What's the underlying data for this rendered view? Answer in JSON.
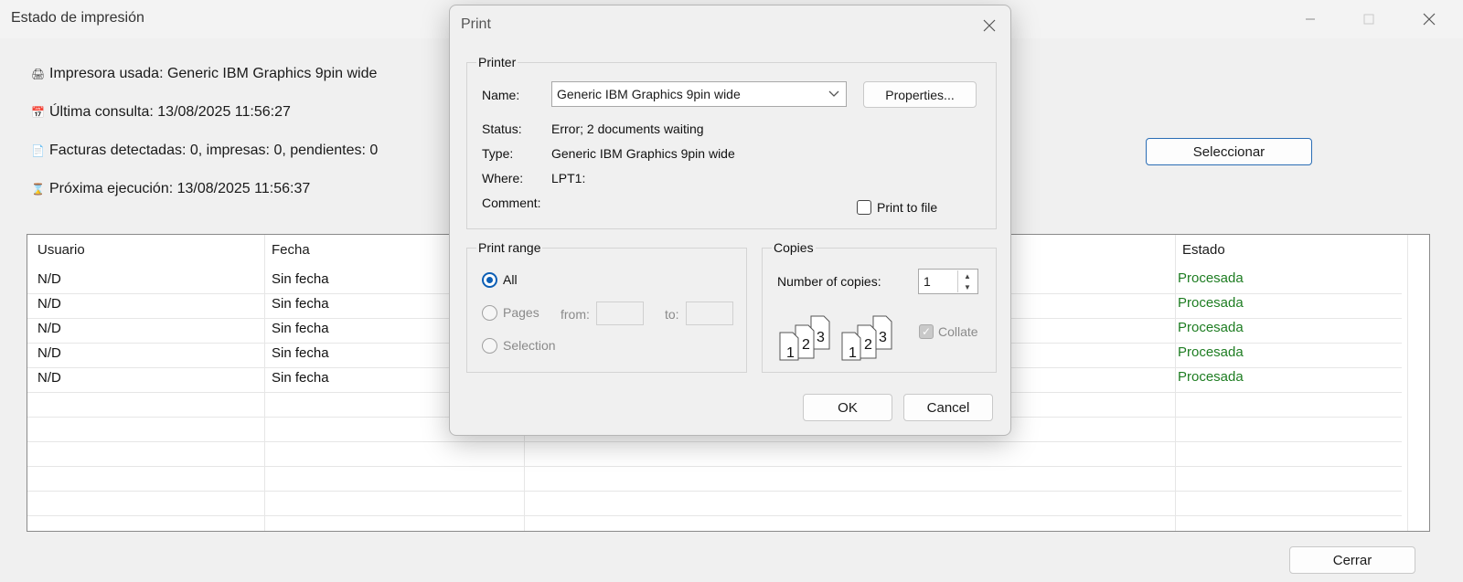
{
  "window": {
    "title": "Estado de impresión",
    "controls": {
      "minimize": "—",
      "maximize": "☐",
      "close": "✕"
    }
  },
  "info": {
    "printer_icon": "🖨",
    "printer": "Impresora usada: Generic IBM Graphics 9pin wide",
    "lastcheck_icon": "📅",
    "last_check": "Última consulta: 13/08/2025 11:56:27",
    "invoices_icon": "📄",
    "invoices": "Facturas detectadas: 0, impresas: 0, pendientes: 0",
    "next_icon": "⌛",
    "next_run": "Próxima ejecución: 13/08/2025 11:56:37"
  },
  "buttons": {
    "select": "Seleccionar",
    "close": "Cerrar"
  },
  "table": {
    "headers": {
      "user": "Usuario",
      "date": "Fecha",
      "status": "Estado"
    },
    "rows": [
      {
        "user": "N/D",
        "date": "Sin fecha",
        "status": "Procesada"
      },
      {
        "user": "N/D",
        "date": "Sin fecha",
        "status": "Procesada"
      },
      {
        "user": "N/D",
        "date": "Sin fecha",
        "status": "Procesada"
      },
      {
        "user": "N/D",
        "date": "Sin fecha",
        "status": "Procesada"
      },
      {
        "user": "N/D",
        "date": "Sin fecha",
        "status": "Procesada"
      }
    ],
    "status_color": "#1e7d22"
  },
  "dialog": {
    "title": "Print",
    "printer_group": "Printer",
    "name_label": "Name:",
    "name_value": "Generic IBM Graphics 9pin wide",
    "properties": "Properties...",
    "status_label": "Status:",
    "status_value": "Error; 2 documents waiting",
    "type_label": "Type:",
    "type_value": "Generic IBM Graphics 9pin wide",
    "where_label": "Where:",
    "where_value": "LPT1:",
    "comment_label": "Comment:",
    "print_to_file": "Print to file",
    "range_group": "Print range",
    "range_all": "All",
    "range_pages": "Pages",
    "from_label": "from:",
    "to_label": "to:",
    "range_selection": "Selection",
    "copies_group": "Copies",
    "copies_label": "Number of copies:",
    "copies_value": "1",
    "collate": "Collate",
    "ok": "OK",
    "cancel": "Cancel"
  },
  "colors": {
    "accent": "#0d5fb5",
    "select_border": "#2a6db5"
  }
}
